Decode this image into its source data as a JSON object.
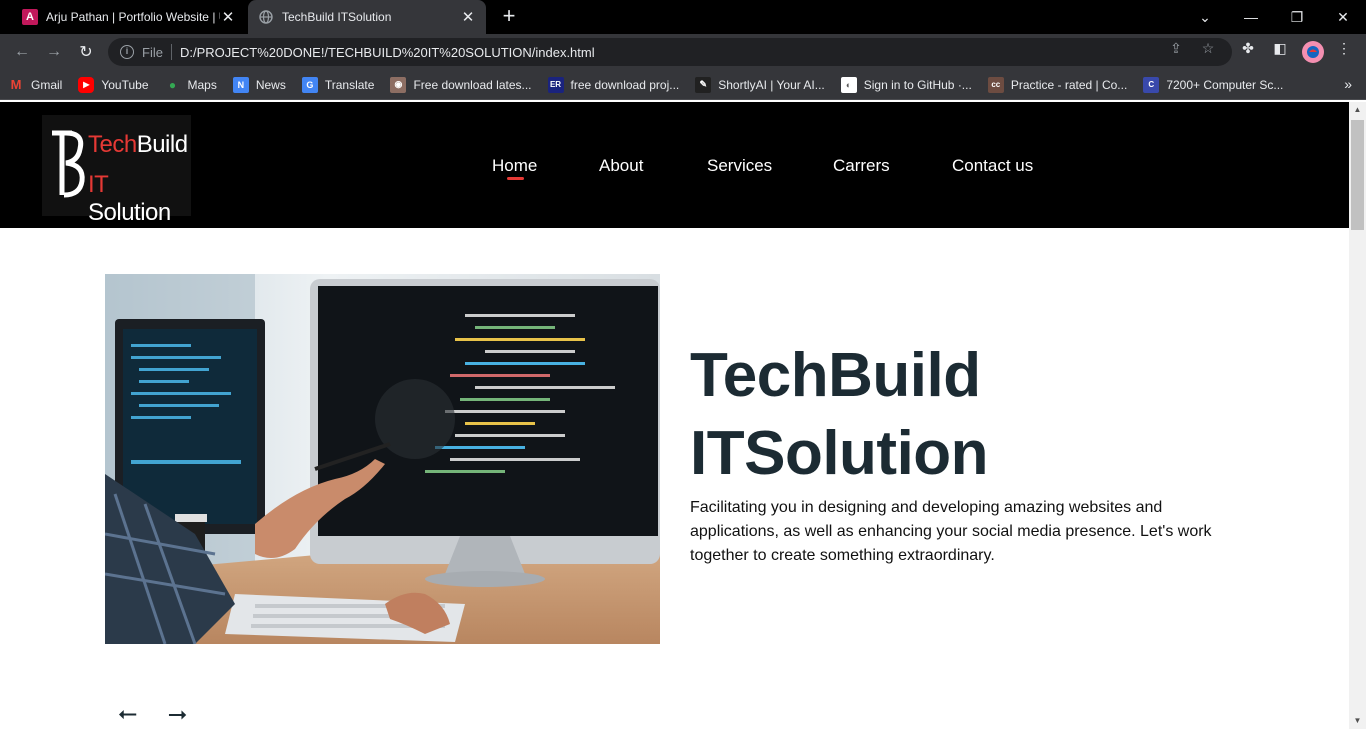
{
  "browser": {
    "tabs": [
      {
        "title": "Arju Pathan | Portfolio Website | U",
        "favicon": "A",
        "favicon_color": "#c2185b"
      },
      {
        "title": "TechBuild ITSolution",
        "favicon": "globe-icon"
      }
    ],
    "omnibox": {
      "scheme": "File",
      "url": "D:/PROJECT%20DONE!/TECHBUILD%20IT%20SOLUTION/index.html"
    },
    "bookmarks": [
      {
        "label": "Gmail",
        "icon": "M",
        "color": "#ea4335"
      },
      {
        "label": "YouTube",
        "icon": "▶",
        "color": "#ff0000"
      },
      {
        "label": "Maps",
        "icon": "●",
        "color": "#34a853"
      },
      {
        "label": "News",
        "icon": "N",
        "color": "#4285f4"
      },
      {
        "label": "Translate",
        "icon": "G",
        "color": "#4285f4"
      },
      {
        "label": "Free download lates...",
        "icon": "◉",
        "color": "#8d6e63"
      },
      {
        "label": "free download proj...",
        "icon": "ER",
        "color": "#1a237e"
      },
      {
        "label": "ShortlyAI | Your AI...",
        "icon": "✎",
        "color": "#212121"
      },
      {
        "label": "Sign in to GitHub ·...",
        "icon": "◐",
        "color": "#ffffff"
      },
      {
        "label": "Practice - rated | Co...",
        "icon": "cc",
        "color": "#6d4c41"
      },
      {
        "label": "7200+ Computer Sc...",
        "icon": "C",
        "color": "#3949ab"
      }
    ]
  },
  "site": {
    "logo": {
      "line1_a": "Tech",
      "line1_b": "Build",
      "line2_a": "IT",
      "line2_b": " Solution"
    },
    "nav": [
      "Home",
      "About",
      "Services",
      "Carrers",
      "Contact us"
    ],
    "hero": {
      "title_line1": "TechBuild",
      "title_line2": "ITSolution",
      "description": "Facilitating you in designing and developing amazing websites and applications, as well as enhancing your social media presence. Let's work together to create something extraordinary."
    },
    "arrows": {
      "prev": "⭠",
      "next": "⭢"
    }
  },
  "colors": {
    "accent": "#e53935",
    "title": "#1c2b33"
  }
}
